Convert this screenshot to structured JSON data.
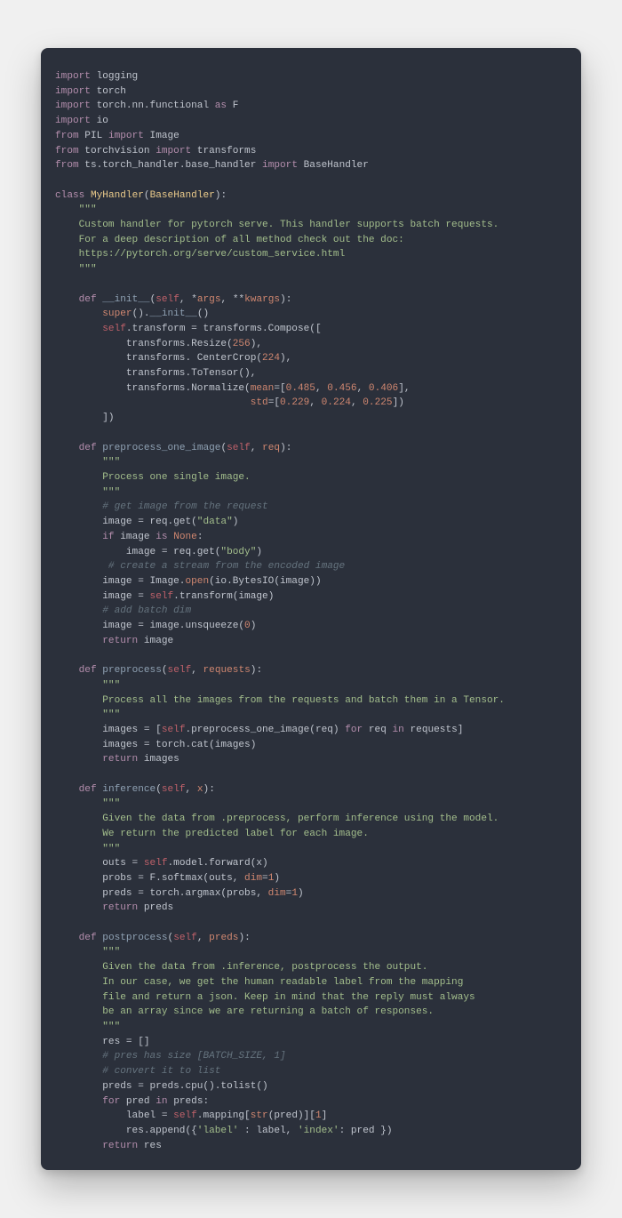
{
  "code": {
    "lines": [
      [
        [
          "kw",
          "import"
        ],
        [
          "op",
          " logging"
        ]
      ],
      [
        [
          "kw",
          "import"
        ],
        [
          "op",
          " torch"
        ]
      ],
      [
        [
          "kw",
          "import"
        ],
        [
          "op",
          " torch.nn.functional "
        ],
        [
          "kw",
          "as"
        ],
        [
          "op",
          " F"
        ]
      ],
      [
        [
          "kw",
          "import"
        ],
        [
          "op",
          " io"
        ]
      ],
      [
        [
          "kw",
          "from"
        ],
        [
          "op",
          " PIL "
        ],
        [
          "kw",
          "import"
        ],
        [
          "op",
          " Image"
        ]
      ],
      [
        [
          "kw",
          "from"
        ],
        [
          "op",
          " torchvision "
        ],
        [
          "kw",
          "import"
        ],
        [
          "op",
          " transforms"
        ]
      ],
      [
        [
          "kw",
          "from"
        ],
        [
          "op",
          " ts.torch_handler.base_handler "
        ],
        [
          "kw",
          "import"
        ],
        [
          "op",
          " BaseHandler"
        ]
      ],
      [
        [
          "op",
          ""
        ]
      ],
      [
        [
          "kw",
          "class"
        ],
        [
          "op",
          " "
        ],
        [
          "cls",
          "MyHandler"
        ],
        [
          "op",
          "("
        ],
        [
          "cls",
          "BaseHandler"
        ],
        [
          "op",
          "):"
        ]
      ],
      [
        [
          "op",
          "    "
        ],
        [
          "st",
          "\"\"\""
        ]
      ],
      [
        [
          "op",
          "    "
        ],
        [
          "st",
          "Custom handler for pytorch serve. This handler supports batch requests."
        ]
      ],
      [
        [
          "op",
          "    "
        ],
        [
          "st",
          "For a deep description of all method check out the doc:"
        ]
      ],
      [
        [
          "op",
          "    "
        ],
        [
          "st",
          "https://pytorch.org/serve/custom_service.html"
        ]
      ],
      [
        [
          "op",
          "    "
        ],
        [
          "st",
          "\"\"\""
        ]
      ],
      [
        [
          "op",
          ""
        ]
      ],
      [
        [
          "op",
          "    "
        ],
        [
          "kw",
          "def"
        ],
        [
          "op",
          " "
        ],
        [
          "fn",
          "__init__"
        ],
        [
          "op",
          "("
        ],
        [
          "slf",
          "self"
        ],
        [
          "op",
          ", *"
        ],
        [
          "nmarg",
          "args"
        ],
        [
          "op",
          ", **"
        ],
        [
          "nmarg",
          "kwargs"
        ],
        [
          "op",
          "):"
        ]
      ],
      [
        [
          "op",
          "        "
        ],
        [
          "bi",
          "super"
        ],
        [
          "op",
          "()."
        ],
        [
          "fn",
          "__init__"
        ],
        [
          "op",
          "()"
        ]
      ],
      [
        [
          "op",
          "        "
        ],
        [
          "slf",
          "self"
        ],
        [
          "op",
          ".transform = transforms.Compose(["
        ]
      ],
      [
        [
          "op",
          "            transforms.Resize("
        ],
        [
          "nm",
          "256"
        ],
        [
          "op",
          "),"
        ]
      ],
      [
        [
          "op",
          "            transforms. CenterCrop("
        ],
        [
          "nm",
          "224"
        ],
        [
          "op",
          "),"
        ]
      ],
      [
        [
          "op",
          "            transforms.ToTensor(),"
        ]
      ],
      [
        [
          "op",
          "            transforms.Normalize("
        ],
        [
          "nmarg",
          "mean"
        ],
        [
          "op",
          "=["
        ],
        [
          "nm",
          "0.485"
        ],
        [
          "op",
          ", "
        ],
        [
          "nm",
          "0.456"
        ],
        [
          "op",
          ", "
        ],
        [
          "nm",
          "0.406"
        ],
        [
          "op",
          "],"
        ]
      ],
      [
        [
          "op",
          "                                 "
        ],
        [
          "nmarg",
          "std"
        ],
        [
          "op",
          "=["
        ],
        [
          "nm",
          "0.229"
        ],
        [
          "op",
          ", "
        ],
        [
          "nm",
          "0.224"
        ],
        [
          "op",
          ", "
        ],
        [
          "nm",
          "0.225"
        ],
        [
          "op",
          "])"
        ]
      ],
      [
        [
          "op",
          "        ])"
        ]
      ],
      [
        [
          "op",
          ""
        ]
      ],
      [
        [
          "op",
          "    "
        ],
        [
          "kw",
          "def"
        ],
        [
          "op",
          " "
        ],
        [
          "fn",
          "preprocess_one_image"
        ],
        [
          "op",
          "("
        ],
        [
          "slf",
          "self"
        ],
        [
          "op",
          ", "
        ],
        [
          "nmarg",
          "req"
        ],
        [
          "op",
          "):"
        ]
      ],
      [
        [
          "op",
          "        "
        ],
        [
          "st",
          "\"\"\""
        ]
      ],
      [
        [
          "op",
          "        "
        ],
        [
          "st",
          "Process one single image."
        ]
      ],
      [
        [
          "op",
          "        "
        ],
        [
          "st",
          "\"\"\""
        ]
      ],
      [
        [
          "op",
          "        "
        ],
        [
          "cm",
          "# get image from the request"
        ]
      ],
      [
        [
          "op",
          "        image = req.get("
        ],
        [
          "st",
          "\"data\""
        ],
        [
          "op",
          ")"
        ]
      ],
      [
        [
          "op",
          "        "
        ],
        [
          "kw",
          "if"
        ],
        [
          "op",
          " image "
        ],
        [
          "kw",
          "is"
        ],
        [
          "op",
          " "
        ],
        [
          "bi",
          "None"
        ],
        [
          "op",
          ":"
        ]
      ],
      [
        [
          "op",
          "            image = req.get("
        ],
        [
          "st",
          "\"body\""
        ],
        [
          "op",
          ")"
        ]
      ],
      [
        [
          "op",
          "         "
        ],
        [
          "cm",
          "# create a stream from the encoded image"
        ]
      ],
      [
        [
          "op",
          "        image = Image."
        ],
        [
          "bi",
          "open"
        ],
        [
          "op",
          "(io.BytesIO(image))"
        ]
      ],
      [
        [
          "op",
          "        image = "
        ],
        [
          "slf",
          "self"
        ],
        [
          "op",
          ".transform(image)"
        ]
      ],
      [
        [
          "op",
          "        "
        ],
        [
          "cm",
          "# add batch dim"
        ]
      ],
      [
        [
          "op",
          "        image = image.unsqueeze("
        ],
        [
          "nm",
          "0"
        ],
        [
          "op",
          ")"
        ]
      ],
      [
        [
          "op",
          "        "
        ],
        [
          "kw",
          "return"
        ],
        [
          "op",
          " image"
        ]
      ],
      [
        [
          "op",
          ""
        ]
      ],
      [
        [
          "op",
          "    "
        ],
        [
          "kw",
          "def"
        ],
        [
          "op",
          " "
        ],
        [
          "fn",
          "preprocess"
        ],
        [
          "op",
          "("
        ],
        [
          "slf",
          "self"
        ],
        [
          "op",
          ", "
        ],
        [
          "nmarg",
          "requests"
        ],
        [
          "op",
          "):"
        ]
      ],
      [
        [
          "op",
          "        "
        ],
        [
          "st",
          "\"\"\""
        ]
      ],
      [
        [
          "op",
          "        "
        ],
        [
          "st",
          "Process all the images from the requests and batch them in a Tensor."
        ]
      ],
      [
        [
          "op",
          "        "
        ],
        [
          "st",
          "\"\"\""
        ]
      ],
      [
        [
          "op",
          "        images = ["
        ],
        [
          "slf",
          "self"
        ],
        [
          "op",
          ".preprocess_one_image(req) "
        ],
        [
          "kw",
          "for"
        ],
        [
          "op",
          " req "
        ],
        [
          "kw",
          "in"
        ],
        [
          "op",
          " requests]"
        ]
      ],
      [
        [
          "op",
          "        images = torch.cat(images)"
        ]
      ],
      [
        [
          "op",
          "        "
        ],
        [
          "kw",
          "return"
        ],
        [
          "op",
          " images"
        ]
      ],
      [
        [
          "op",
          ""
        ]
      ],
      [
        [
          "op",
          "    "
        ],
        [
          "kw",
          "def"
        ],
        [
          "op",
          " "
        ],
        [
          "fn",
          "inference"
        ],
        [
          "op",
          "("
        ],
        [
          "slf",
          "self"
        ],
        [
          "op",
          ", "
        ],
        [
          "nmarg",
          "x"
        ],
        [
          "op",
          "):"
        ]
      ],
      [
        [
          "op",
          "        "
        ],
        [
          "st",
          "\"\"\""
        ]
      ],
      [
        [
          "op",
          "        "
        ],
        [
          "st",
          "Given the data from .preprocess, perform inference using the model."
        ]
      ],
      [
        [
          "op",
          "        "
        ],
        [
          "st",
          "We return the predicted label for each image."
        ]
      ],
      [
        [
          "op",
          "        "
        ],
        [
          "st",
          "\"\"\""
        ]
      ],
      [
        [
          "op",
          "        outs = "
        ],
        [
          "slf",
          "self"
        ],
        [
          "op",
          ".model.forward(x)"
        ]
      ],
      [
        [
          "op",
          "        probs = F.softmax(outs, "
        ],
        [
          "nmarg",
          "dim"
        ],
        [
          "op",
          "="
        ],
        [
          "nm",
          "1"
        ],
        [
          "op",
          ")"
        ]
      ],
      [
        [
          "op",
          "        preds = torch.argmax(probs, "
        ],
        [
          "nmarg",
          "dim"
        ],
        [
          "op",
          "="
        ],
        [
          "nm",
          "1"
        ],
        [
          "op",
          ")"
        ]
      ],
      [
        [
          "op",
          "        "
        ],
        [
          "kw",
          "return"
        ],
        [
          "op",
          " preds"
        ]
      ],
      [
        [
          "op",
          ""
        ]
      ],
      [
        [
          "op",
          "    "
        ],
        [
          "kw",
          "def"
        ],
        [
          "op",
          " "
        ],
        [
          "fn",
          "postprocess"
        ],
        [
          "op",
          "("
        ],
        [
          "slf",
          "self"
        ],
        [
          "op",
          ", "
        ],
        [
          "nmarg",
          "preds"
        ],
        [
          "op",
          "):"
        ]
      ],
      [
        [
          "op",
          "        "
        ],
        [
          "st",
          "\"\"\""
        ]
      ],
      [
        [
          "op",
          "        "
        ],
        [
          "st",
          "Given the data from .inference, postprocess the output."
        ]
      ],
      [
        [
          "op",
          "        "
        ],
        [
          "st",
          "In our case, we get the human readable label from the mapping"
        ]
      ],
      [
        [
          "op",
          "        "
        ],
        [
          "st",
          "file and return a json. Keep in mind that the reply must always"
        ]
      ],
      [
        [
          "op",
          "        "
        ],
        [
          "st",
          "be an array since we are returning a batch of responses."
        ]
      ],
      [
        [
          "op",
          "        "
        ],
        [
          "st",
          "\"\"\""
        ]
      ],
      [
        [
          "op",
          "        res = []"
        ]
      ],
      [
        [
          "op",
          "        "
        ],
        [
          "cm",
          "# pres has size [BATCH_SIZE, 1]"
        ]
      ],
      [
        [
          "op",
          "        "
        ],
        [
          "cm",
          "# convert it to list"
        ]
      ],
      [
        [
          "op",
          "        preds = preds.cpu().tolist()"
        ]
      ],
      [
        [
          "op",
          "        "
        ],
        [
          "kw",
          "for"
        ],
        [
          "op",
          " pred "
        ],
        [
          "kw",
          "in"
        ],
        [
          "op",
          " preds:"
        ]
      ],
      [
        [
          "op",
          "            label = "
        ],
        [
          "slf",
          "self"
        ],
        [
          "op",
          ".mapping["
        ],
        [
          "bi",
          "str"
        ],
        [
          "op",
          "(pred)]["
        ],
        [
          "nm",
          "1"
        ],
        [
          "op",
          "]"
        ]
      ],
      [
        [
          "op",
          "            res.append({"
        ],
        [
          "st",
          "'label'"
        ],
        [
          "op",
          " : label, "
        ],
        [
          "st",
          "'index'"
        ],
        [
          "op",
          ": pred })"
        ]
      ],
      [
        [
          "op",
          "        "
        ],
        [
          "kw",
          "return"
        ],
        [
          "op",
          " res"
        ]
      ]
    ]
  }
}
